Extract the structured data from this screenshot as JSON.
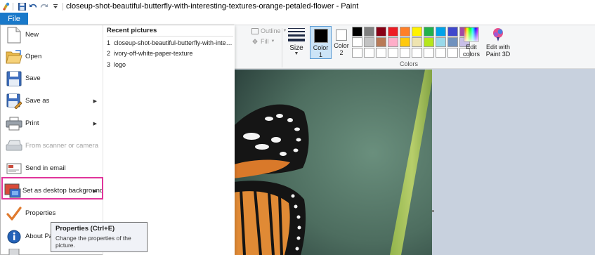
{
  "window": {
    "title": "closeup-shot-beautiful-butterfly-with-interesting-textures-orange-petaled-flower - Paint",
    "qat_icons": [
      "paint-app-icon",
      "save-icon",
      "undo-icon",
      "redo-icon",
      "customize-qat-icon"
    ]
  },
  "ribbon": {
    "file_tab": "File",
    "outline_label": "Outline",
    "fill_label": "Fill",
    "size_label": "Size",
    "color1_label": "Color\n1",
    "color2_label": "Color\n2",
    "colors_group_label": "Colors",
    "edit_colors_label": "Edit\ncolors",
    "paint3d_label": "Edit with\nPaint 3D",
    "color1_value": "#000000",
    "color2_value": "#ffffff",
    "palette": [
      "#000000",
      "#7f7f7f",
      "#880015",
      "#ed1c24",
      "#ff7f27",
      "#fff200",
      "#22b14c",
      "#00a2e8",
      "#3f48cc",
      "#a349a4",
      "#ffffff",
      "#c3c3c3",
      "#b97a57",
      "#ffaec9",
      "#ffc90e",
      "#efe4b0",
      "#b5e61d",
      "#99d9ea",
      "#7092be",
      "#c8bfe7",
      "#ffffff",
      "#ffffff",
      "#ffffff",
      "#ffffff",
      "#ffffff",
      "#ffffff",
      "#ffffff",
      "#ffffff",
      "#ffffff",
      "#ffffff"
    ]
  },
  "file_menu": {
    "items": [
      {
        "label": "New",
        "icon": "new-file-icon",
        "enabled": true,
        "submenu": false
      },
      {
        "label": "Open",
        "icon": "open-folder-icon",
        "enabled": true,
        "submenu": false
      },
      {
        "label": "Save",
        "icon": "save-icon",
        "enabled": true,
        "submenu": false
      },
      {
        "label": "Save as",
        "icon": "save-as-icon",
        "enabled": true,
        "submenu": true
      },
      {
        "label": "Print",
        "icon": "printer-icon",
        "enabled": true,
        "submenu": true
      },
      {
        "label": "From scanner or camera",
        "icon": "scanner-icon",
        "enabled": false,
        "submenu": false
      },
      {
        "label": "Send in email",
        "icon": "email-icon",
        "enabled": true,
        "submenu": false
      },
      {
        "label": "Set as desktop background",
        "icon": "desktop-background-icon",
        "enabled": true,
        "submenu": true
      },
      {
        "label": "Properties",
        "icon": "checkmark-icon",
        "enabled": true,
        "submenu": false
      },
      {
        "label": "About Paint",
        "icon": "info-icon",
        "enabled": true,
        "submenu": false
      }
    ],
    "recent_header": "Recent pictures",
    "recent": [
      {
        "num": "1",
        "name": "closeup-shot-beautiful-butterfly-with-interesting-textures-orange-petaled-flower"
      },
      {
        "num": "2",
        "name": "ivory-off-white-paper-texture"
      },
      {
        "num": "3",
        "name": "logo"
      }
    ]
  },
  "tooltip": {
    "title": "Properties (Ctrl+E)",
    "description": "Change the properties of the picture."
  }
}
